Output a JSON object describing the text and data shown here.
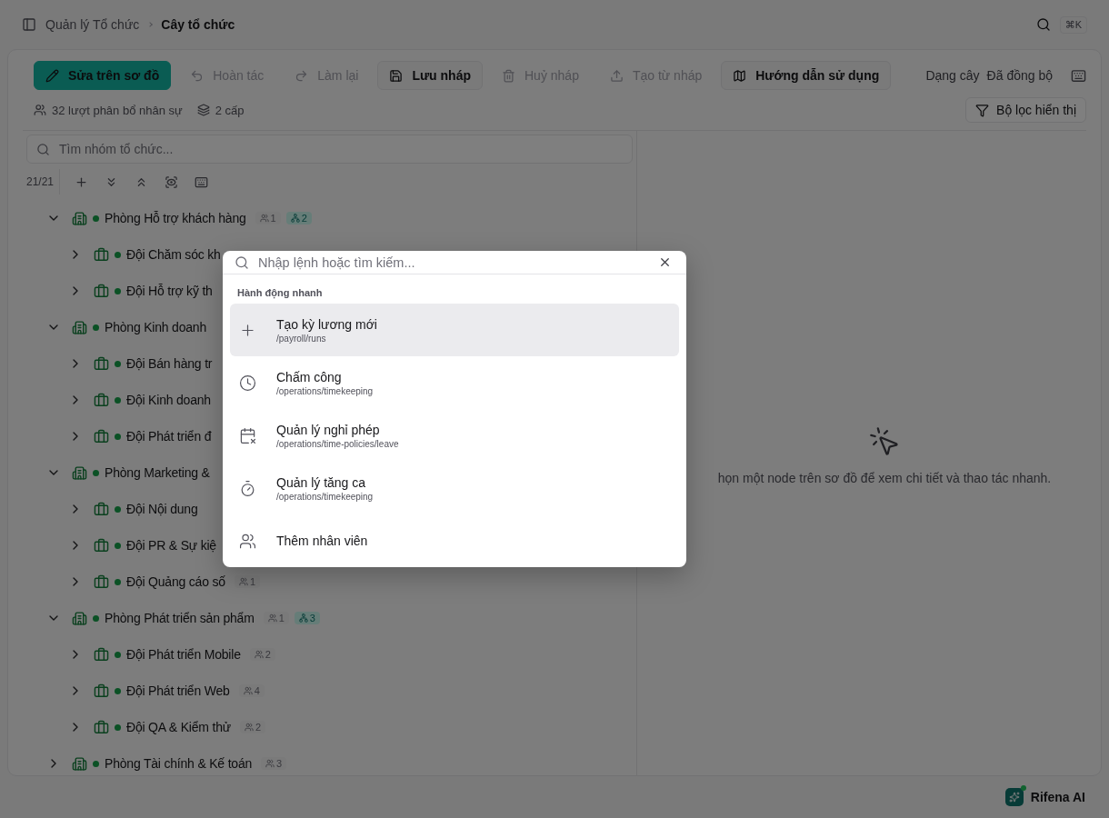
{
  "topbar": {
    "breadcrumbs": [
      "Quản lý Tổ chức",
      "Cây tổ chức"
    ],
    "shortcut": "⌘K"
  },
  "toolbar": {
    "buttons": [
      {
        "label": "Sửa trên sơ đồ",
        "kind": "primary",
        "disabled": false
      },
      {
        "label": "Hoàn tác",
        "kind": "ghost",
        "disabled": true
      },
      {
        "label": "Làm lại",
        "kind": "ghost",
        "disabled": true
      },
      {
        "label": "Lưu nháp",
        "kind": "outlined",
        "disabled": false
      },
      {
        "label": "Huỷ nháp",
        "kind": "ghost",
        "disabled": true
      },
      {
        "label": "Tạo từ nháp",
        "kind": "ghost",
        "disabled": true
      },
      {
        "label": "Hướng dẫn sử dụng",
        "kind": "outlined",
        "disabled": false
      }
    ],
    "view_mode": "Dạng cây",
    "sync_status": "Đã đồng bộ"
  },
  "stats": [
    "32 lượt phân bổ nhân sự",
    "2 cấp"
  ],
  "filter_button": "Bộ lọc hiển thị",
  "tree": {
    "placeholder": "Tìm nhóm tổ chức...",
    "count": "21/21",
    "nodes": [
      {
        "name": "Phòng Hỗ trợ khách hàng",
        "kind": "department",
        "expanded": true,
        "members": "1",
        "units": "2",
        "children": [
          {
            "name": "Đội Chăm sóc kh",
            "kind": "team",
            "expanded": false
          },
          {
            "name": "Đội Hỗ trợ kỹ th",
            "kind": "team",
            "expanded": false
          }
        ]
      },
      {
        "name": "Phòng Kinh doanh",
        "kind": "department",
        "expanded": true,
        "children": [
          {
            "name": "Đội Bán hàng tr",
            "kind": "team",
            "expanded": false
          },
          {
            "name": "Đội Kinh doanh",
            "kind": "team",
            "expanded": false
          },
          {
            "name": "Đội Phát triển đ",
            "kind": "team",
            "expanded": false
          }
        ]
      },
      {
        "name": "Phòng Marketing &",
        "kind": "department",
        "expanded": true,
        "children": [
          {
            "name": "Đội Nội dung",
            "kind": "team",
            "expanded": false
          },
          {
            "name": "Đội PR & Sự kiệ",
            "kind": "team",
            "expanded": false
          },
          {
            "name": "Đội Quảng cáo số",
            "kind": "team",
            "expanded": false,
            "members": "1"
          }
        ]
      },
      {
        "name": "Phòng Phát triển sản phẩm",
        "kind": "department",
        "expanded": true,
        "members": "1",
        "units": "3",
        "children": [
          {
            "name": "Đội Phát triển Mobile",
            "kind": "team",
            "expanded": false,
            "members": "2"
          },
          {
            "name": "Đội Phát triển Web",
            "kind": "team",
            "expanded": false,
            "members": "4"
          },
          {
            "name": "Đội QA & Kiểm thử",
            "kind": "team",
            "expanded": false,
            "members": "2"
          }
        ]
      },
      {
        "name": "Phòng Tài chính & Kế toán",
        "kind": "department",
        "expanded": false,
        "members": "3"
      }
    ]
  },
  "details": {
    "hint": "họn một node trên sơ đồ để xem chi tiết và thao tác nhanh."
  },
  "command_palette": {
    "placeholder": "Nhập lệnh hoặc tìm kiếm...",
    "group": "Hành động nhanh",
    "items": [
      {
        "title": "Tạo kỳ lương mới",
        "path": "/payroll/runs",
        "selected": true
      },
      {
        "title": "Chấm công",
        "path": "/operations/timekeeping",
        "selected": false
      },
      {
        "title": "Quản lý nghỉ phép",
        "path": "/operations/time-policies/leave",
        "selected": false
      },
      {
        "title": "Quản lý tăng ca",
        "path": "/operations/timekeeping",
        "selected": false
      },
      {
        "title": "Thêm nhân viên",
        "selected": false
      }
    ]
  },
  "assistant": {
    "label": "Rifena AI"
  }
}
